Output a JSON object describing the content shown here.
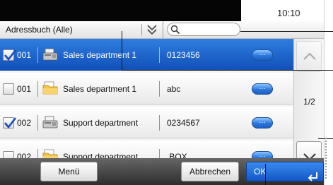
{
  "status": {
    "time": "10:10"
  },
  "addressbook": {
    "selector_label": "Adressbuch (Alle)",
    "search_placeholder": ""
  },
  "rows": [
    {
      "number": "001",
      "name": "Sales department 1",
      "value": "0123456",
      "checked": true,
      "selected": true,
      "icon": "fax-icon",
      "detail_label": "…"
    },
    {
      "number": "001",
      "name": "Sales department 1",
      "value": "abc",
      "checked": false,
      "selected": false,
      "icon": "folder-icon",
      "detail_label": "…"
    },
    {
      "number": "002",
      "name": "Support department",
      "value": "0234567",
      "checked": true,
      "selected": false,
      "icon": "fax-icon",
      "detail_label": "…"
    },
    {
      "number": "002",
      "name": "Support department",
      "value": ".BOX",
      "checked": false,
      "selected": false,
      "icon": "folder-icon",
      "detail_label": "…"
    }
  ],
  "pagination": {
    "page": "1/2"
  },
  "buttons": {
    "menu": "Menü",
    "cancel": "Abbrechen",
    "ok": "OK"
  },
  "colors": {
    "selection_blue": "#1f66cc",
    "detail_button": "#2a78de",
    "ok_button": "#1157c6"
  }
}
